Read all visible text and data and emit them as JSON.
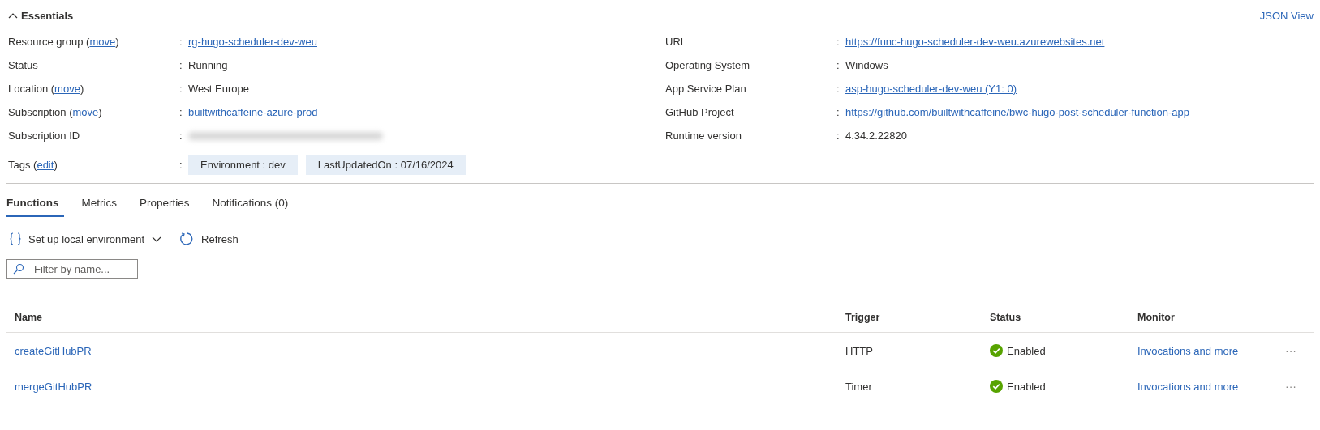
{
  "essentials": {
    "title": "Essentials",
    "expanded": true,
    "json_view": "JSON View",
    "left": [
      {
        "label": "Resource group (",
        "label_link": "move",
        "label_end": ")",
        "colon": ":",
        "kind": "link",
        "value": "rg-hugo-scheduler-dev-weu"
      },
      {
        "label": "Status",
        "colon": ":",
        "kind": "text",
        "value": "Running"
      },
      {
        "label": "Location (",
        "label_link": "move",
        "label_end": ")",
        "colon": ":",
        "kind": "text",
        "value": "West Europe"
      },
      {
        "label": "Subscription (",
        "label_link": "move",
        "label_end": ")",
        "colon": ":",
        "kind": "link",
        "value": "builtwithcaffeine-azure-prod"
      },
      {
        "label": "Subscription ID",
        "colon": ":",
        "kind": "redacted"
      }
    ],
    "right": [
      {
        "label": "URL",
        "colon": ":",
        "kind": "link",
        "value": "https://func-hugo-scheduler-dev-weu.azurewebsites.net"
      },
      {
        "label": "Operating System",
        "colon": ":",
        "kind": "text",
        "value": "Windows"
      },
      {
        "label": "App Service Plan",
        "colon": ":",
        "kind": "link",
        "value": "asp-hugo-scheduler-dev-weu (Y1: 0)"
      },
      {
        "label": "GitHub Project",
        "colon": ":",
        "kind": "link",
        "value": "https://github.com/builtwithcaffeine/bwc-hugo-post-scheduler-function-app"
      },
      {
        "label": "Runtime version",
        "colon": ":",
        "kind": "text",
        "value": "4.34.2.22820"
      }
    ],
    "tags": {
      "label": "Tags (",
      "label_link": "edit",
      "label_end": ")",
      "colon": ":",
      "items": [
        "Environment : dev",
        "LastUpdatedOn : 07/16/2024"
      ]
    }
  },
  "tabs": [
    {
      "label": "Functions",
      "selected": true
    },
    {
      "label": "Metrics",
      "selected": false
    },
    {
      "label": "Properties",
      "selected": false
    },
    {
      "label": "Notifications (0)",
      "selected": false
    }
  ],
  "toolbar": {
    "setup": "Set up local environment",
    "refresh": "Refresh"
  },
  "filter": {
    "placeholder": "Filter by name..."
  },
  "table": {
    "columns": [
      "Name",
      "Trigger",
      "Status",
      "Monitor"
    ],
    "rows": [
      {
        "name": "createGitHubPR",
        "trigger": "HTTP",
        "status": "Enabled",
        "ok": true,
        "monitor": "Invocations and more",
        "more": "···"
      },
      {
        "name": "mergeGitHubPR",
        "trigger": "Timer",
        "status": "Enabled",
        "ok": true,
        "monitor": "Invocations and more",
        "more": "···"
      }
    ]
  }
}
